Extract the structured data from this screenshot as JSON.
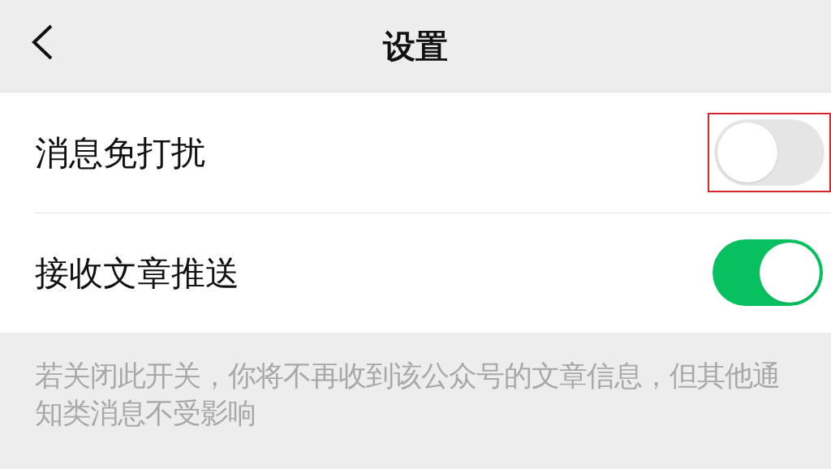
{
  "header": {
    "title": "设置"
  },
  "settings": [
    {
      "label": "消息免打扰",
      "on": false,
      "highlighted": true
    },
    {
      "label": "接收文章推送",
      "on": true,
      "highlighted": false
    }
  ],
  "footer_note": "若关闭此开关，你将不再收到该公众号的文章信息，但其他通知类消息不受影响"
}
